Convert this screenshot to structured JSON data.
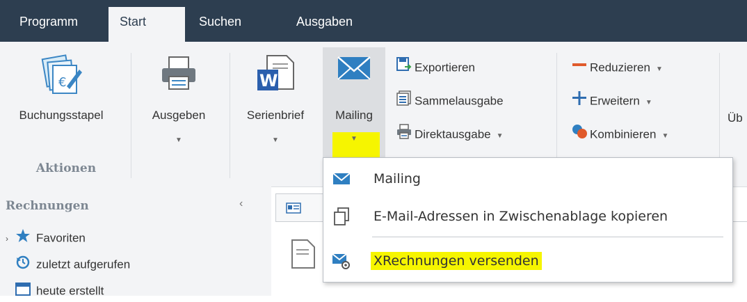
{
  "tabs": [
    "Programm",
    "Start",
    "Suchen",
    "Ausgaben"
  ],
  "ribbon": {
    "buchungsstapel": "Buchungsstapel",
    "ausgeben": "Ausgeben",
    "serienbrief": "Serienbrief",
    "mailing": "Mailing",
    "exportieren": "Exportieren",
    "sammelausgabe": "Sammelausgabe",
    "direktausgabe": "Direktausgabe",
    "reduzieren": "Reduzieren",
    "erweitern": "Erweitern",
    "kombinieren": "Kombinieren",
    "cut_label": "Üb",
    "group_label": "Aktionen"
  },
  "leftpanel": {
    "header": "Rechnungen",
    "items": [
      "Favoriten",
      "zuletzt aufgerufen",
      "heute erstellt"
    ]
  },
  "dropdown": {
    "items": [
      "Mailing",
      "E-Mail-Adressen in Zwischenablage kopieren",
      "XRechnungen versenden"
    ]
  },
  "colors": {
    "titlebar": "#2d3e50",
    "ribbon_bg": "#f3f4f6",
    "highlight": "#f6f500",
    "mail_blue": "#2f7fc1",
    "reduce_red": "#e05a2b"
  }
}
